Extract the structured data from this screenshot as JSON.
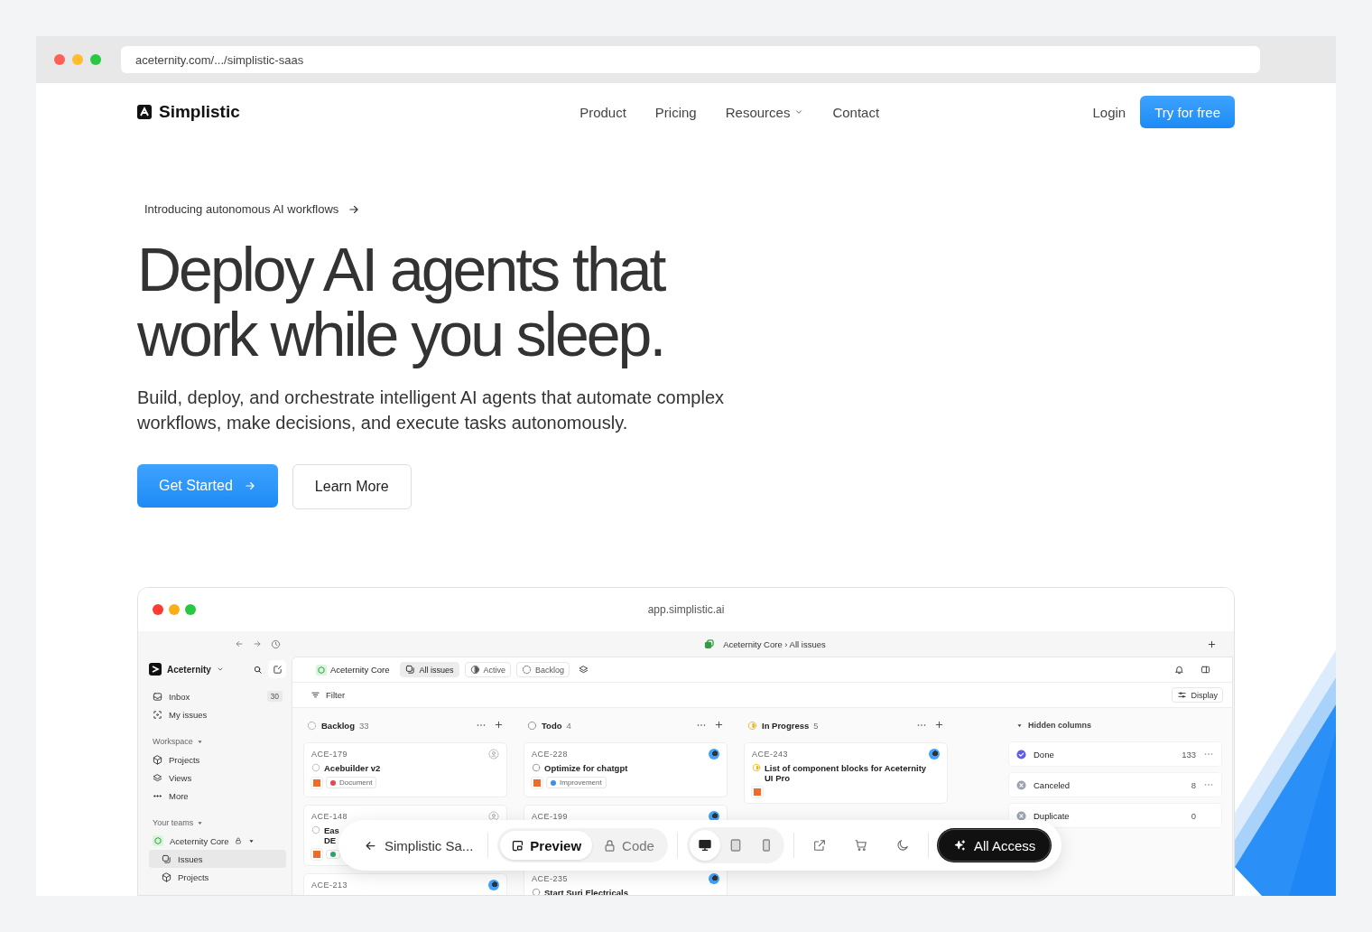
{
  "browser": {
    "url": "aceternity.com/.../simplistic-saas"
  },
  "nav": {
    "brand": "Simplistic",
    "links": [
      {
        "label": "Product",
        "dropdown": false
      },
      {
        "label": "Pricing",
        "dropdown": false
      },
      {
        "label": "Resources",
        "dropdown": true
      },
      {
        "label": "Contact",
        "dropdown": false
      }
    ],
    "login": "Login",
    "cta": "Try for free"
  },
  "hero": {
    "announcement": "Introducing autonomous AI workflows",
    "heading_lines": [
      "Deploy AI agents that",
      "work while you sleep."
    ],
    "description": "Build, deploy, and orchestrate intelligent AI agents that automate complex workflows, make decisions, and execute tasks autonomously.",
    "primary_button": "Get Started",
    "secondary_button": "Learn More"
  },
  "preview": {
    "url": "app.simplistic.ai",
    "breadcrumb": "Aceternity Core › All issues",
    "sidebar": {
      "workspace": "Aceternity",
      "items": [
        {
          "label": "Inbox",
          "badge": "30",
          "selected": false
        },
        {
          "label": "My issues",
          "selected": false
        }
      ],
      "sections": [
        {
          "title": "Workspace",
          "items": [
            {
              "label": "Projects",
              "selected": false
            },
            {
              "label": "Views",
              "selected": false
            },
            {
              "label": "More",
              "selected": false
            }
          ]
        },
        {
          "title": "Your teams",
          "items": [
            {
              "label": "Aceternity Core",
              "selected": false,
              "children": [
                {
                  "label": "Issues",
                  "selected": true
                },
                {
                  "label": "Projects",
                  "selected": false
                }
              ]
            }
          ]
        }
      ]
    },
    "tabs": [
      {
        "label": "Aceternity Core",
        "selected": false
      },
      {
        "label": "All issues",
        "selected": true
      },
      {
        "label": "Active",
        "selected": false
      },
      {
        "label": "Backlog",
        "selected": false
      }
    ],
    "filter": "Filter",
    "display": "Display",
    "columns": [
      {
        "kind": "backlog",
        "title": "Backlog",
        "count": "33",
        "cards": [
          {
            "id": "ACE-179",
            "title_lines": [
              "Acebuilder v2"
            ],
            "assigned": false,
            "urgent": true,
            "label": {
              "text": "Document",
              "color": "#e5484d"
            }
          },
          {
            "id": "ACE-148",
            "title_lines": [
              "Eas",
              "DE"
            ],
            "assigned": false,
            "urgent": true,
            "label": {
              "color": "#30a46c"
            }
          },
          {
            "id": "ACE-213",
            "assigned": true,
            "urgent": false
          }
        ]
      },
      {
        "kind": "todo",
        "title": "Todo",
        "count": "4",
        "cards": [
          {
            "id": "ACE-228",
            "title_lines": [
              "Optimize for chatgpt"
            ],
            "assigned": true,
            "urgent": true,
            "label": {
              "text": "Improvement",
              "color": "#3e8ee8"
            }
          },
          {
            "id": "ACE-199",
            "assigned": true,
            "urgent": false
          },
          {
            "id": "ACE-235",
            "title_lines": [
              "Start Suri Electricals"
            ],
            "assigned": true,
            "urgent": false
          }
        ]
      },
      {
        "kind": "in_progress",
        "title": "In Progress",
        "count": "5",
        "cards": [
          {
            "id": "ACE-243",
            "title_lines": [
              "List of component blocks for Aceternity",
              "UI Pro"
            ],
            "assigned": true,
            "urgent": true
          }
        ]
      }
    ],
    "hidden_columns": {
      "title": "Hidden columns",
      "items": [
        {
          "kind": "done",
          "title": "Done",
          "count": "133",
          "menu": true
        },
        {
          "kind": "canceled",
          "title": "Canceled",
          "count": "8",
          "menu": true
        },
        {
          "kind": "duplicate",
          "title": "Duplicate",
          "count": "0",
          "menu": false
        }
      ]
    }
  },
  "toolbar": {
    "back": "Simplistic Sa...",
    "modes": [
      {
        "label": "Preview",
        "selected": true
      },
      {
        "label": "Code",
        "selected": false
      }
    ],
    "devices": [
      {
        "kind": "desktop",
        "selected": true
      },
      {
        "kind": "tablet",
        "selected": false
      },
      {
        "kind": "phone",
        "selected": false
      }
    ],
    "cta": "All Access"
  }
}
